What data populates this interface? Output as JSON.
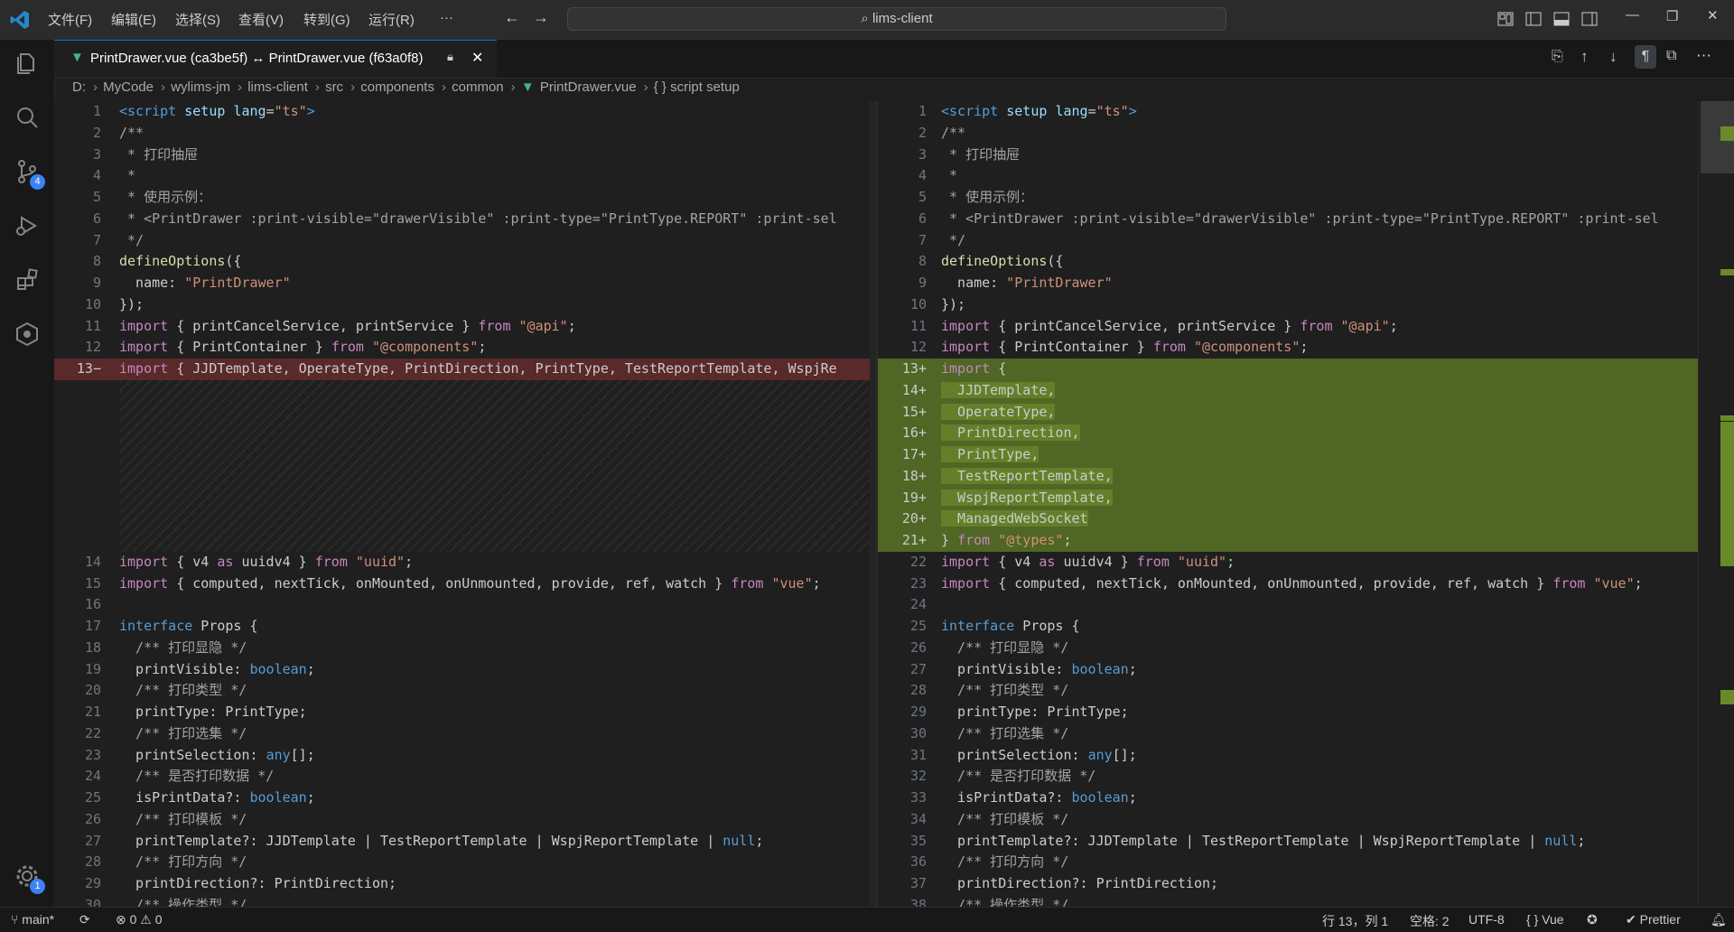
{
  "titlebar": {
    "menus": [
      "文件(F)",
      "编辑(E)",
      "选择(S)",
      "查看(V)",
      "转到(G)",
      "运行(R)",
      "···"
    ],
    "search": "lims-client"
  },
  "activity_bar": {
    "source_control_badge": "4",
    "settings_badge": "1"
  },
  "tab": {
    "title": "PrintDrawer.vue (ca3be5f) ↔ PrintDrawer.vue (f63a0f8)",
    "close": "✕"
  },
  "breadcrumb": [
    "D:",
    "MyCode",
    "wylims-jm",
    "lims-client",
    "src",
    "components",
    "common",
    "PrintDrawer.vue",
    "{ } script setup"
  ],
  "left_editor": {
    "line_numbers": [
      "1",
      "2",
      "3",
      "4",
      "5",
      "6",
      "7",
      "8",
      "9",
      "10",
      "11",
      "12",
      "13",
      "14",
      "15",
      "16",
      "17",
      "18",
      "19",
      "20",
      "21",
      "22",
      "23",
      "24",
      "25",
      "26",
      "27",
      "28",
      "29",
      "30"
    ]
  },
  "right_editor": {
    "line_numbers": [
      "1",
      "2",
      "3",
      "4",
      "5",
      "6",
      "7",
      "8",
      "9",
      "10",
      "11",
      "12",
      "13+",
      "14+",
      "15+",
      "16+",
      "17+",
      "18+",
      "19+",
      "20+",
      "21+",
      "22",
      "23",
      "24",
      "25",
      "26",
      "27",
      "28",
      "29",
      "30",
      "31",
      "32",
      "33",
      "34",
      "35",
      "36",
      "37",
      "38"
    ]
  },
  "code": {
    "l1": "<script setup lang=\"ts\">",
    "l2": "/**",
    "l3": " * 打印抽屉",
    "l4": " *",
    "l5": " * 使用示例：",
    "l6": " * <PrintDrawer :print-visible=\"drawerVisible\" :print-type=\"PrintType.REPORT\" :print-sel",
    "l7": " */",
    "l8": "defineOptions({",
    "l9": "  name: \"PrintDrawer\"",
    "l10": "});",
    "l11": "import { printCancelService, printService } from \"@api\";",
    "l12": "import { PrintContainer } from \"@components\";",
    "l13_left": "import { JJDTemplate, OperateType, PrintDirection, PrintType, TestReportTemplate, WspjRe",
    "l13_right": "import {",
    "add_items": [
      "  JJDTemplate,",
      "  OperateType,",
      "  PrintDirection,",
      "  PrintType,",
      "  TestReportTemplate,",
      "  WspjReportTemplate,",
      "  ManagedWebSocket"
    ],
    "l21_right": "} from \"@types\";",
    "uuid": "import { v4 as uuidv4 } from \"uuid\";",
    "vue": "import { computed, nextTick, onMounted, onUnmounted, provide, ref, watch } from \"vue\";",
    "blank": "",
    "iface": "interface Props {",
    "c_visible": "  /** 打印显隐 */",
    "p_visible": "  printVisible: boolean;",
    "c_type": "  /** 打印类型 */",
    "p_type": "  printType: PrintType;",
    "c_sel": "  /** 打印选集 */",
    "p_sel": "  printSelection: any[];",
    "c_data": "  /** 是否打印数据 */",
    "p_data": "  isPrintData?: boolean;",
    "c_tpl": "  /** 打印模板 */",
    "p_tpl": "  printTemplate?: JJDTemplate | TestReportTemplate | WspjReportTemplate | null;",
    "c_dir": "  /** 打印方向 */",
    "p_dir": "  printDirection?: PrintDirection;",
    "c_op": "  /** 操作类型 */"
  },
  "statusbar": {
    "branch": "main*",
    "problems": "⊗ 0 ⚠ 0",
    "position": "行 13，列 1",
    "spaces": "空格: 2",
    "encoding": "UTF-8",
    "language": "Vue",
    "formatter": "Prettier"
  }
}
